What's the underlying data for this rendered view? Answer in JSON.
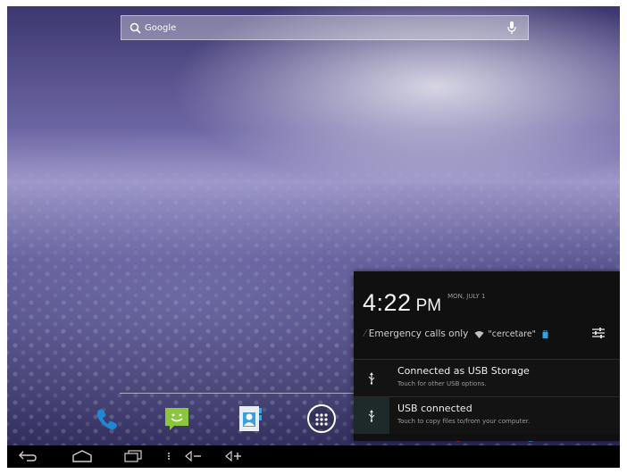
{
  "search": {
    "placeholder": "Google"
  },
  "dock": {
    "items": [
      {
        "name": "phone"
      },
      {
        "name": "messaging"
      },
      {
        "name": "contacts"
      },
      {
        "name": "all-apps"
      }
    ]
  },
  "notification_panel": {
    "time": "4:22",
    "ampm": "PM",
    "date": "MON, JULY 1",
    "status_text": "Emergency calls only",
    "wifi_ssid": "\"cercetare\"",
    "notifications": [
      {
        "title": "Connected as USB Storage",
        "subtitle": "Touch for other USB options."
      },
      {
        "title": "USB connected",
        "subtitle": "Touch to copy files to/from your computer."
      }
    ]
  },
  "colors": {
    "panel_bg": "#101010",
    "phone_icon": "#1e88d8",
    "messaging_icon": "#8cc63f",
    "usb_icon": "#e6e6e6"
  },
  "icons": [
    "search-icon",
    "mic-icon",
    "phone-icon",
    "messaging-icon",
    "contacts-icon",
    "all-apps-icon",
    "back-icon",
    "home-icon",
    "recents-icon",
    "menu-icon",
    "volume-down-icon",
    "volume-up-icon",
    "wifi-icon",
    "lock-icon",
    "settings-icon",
    "usb-icon"
  ]
}
